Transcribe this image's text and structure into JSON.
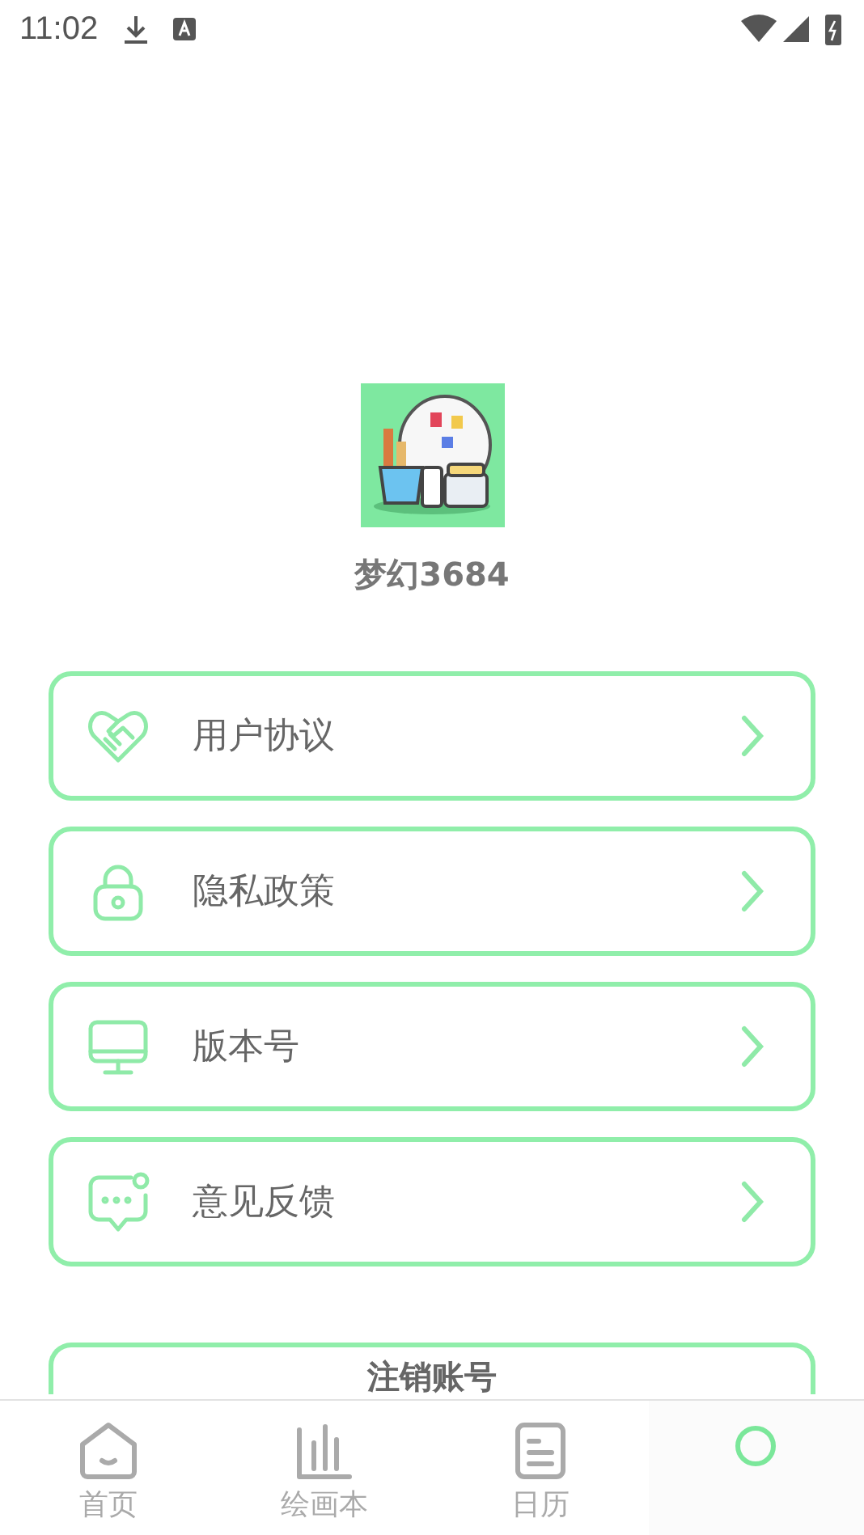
{
  "status_bar": {
    "time": "11:02"
  },
  "profile": {
    "name": "梦幻3684"
  },
  "menu": [
    {
      "kind": "heart",
      "label": "用户协议"
    },
    {
      "kind": "lock",
      "label": "隐私政策"
    },
    {
      "kind": "monitor",
      "label": "版本号"
    },
    {
      "kind": "chat",
      "label": "意见反馈"
    }
  ],
  "logout_button": "注销账号",
  "bottom_nav": [
    {
      "kind": "home",
      "label": "首页",
      "selected": false
    },
    {
      "kind": "chart",
      "label": "绘画本",
      "selected": false
    },
    {
      "kind": "doc",
      "label": "日历",
      "selected": false
    },
    {
      "kind": "circle",
      "selected": true
    }
  ]
}
